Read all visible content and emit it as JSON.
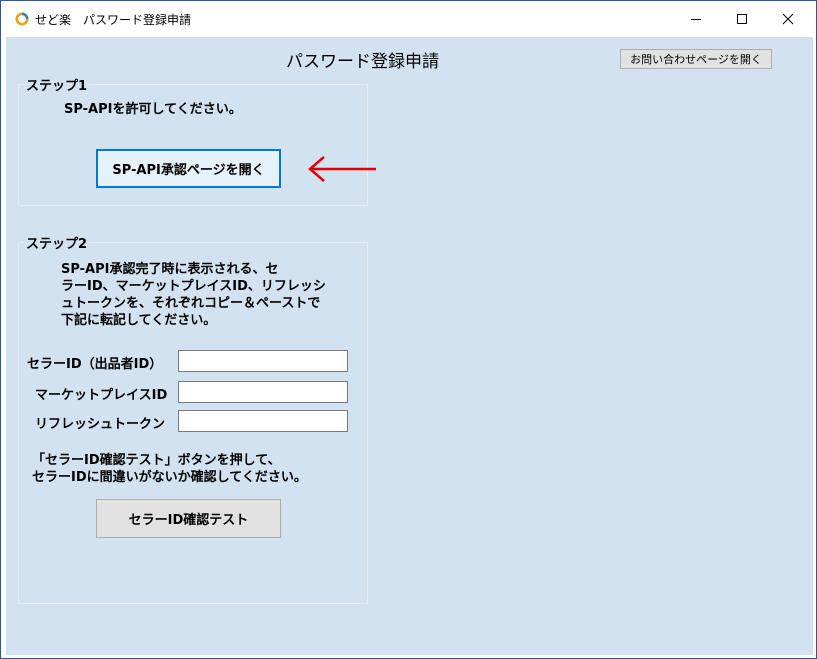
{
  "window": {
    "title": "せど楽　パスワード登録申請"
  },
  "header": {
    "title": "パスワード登録申請",
    "contact_button": "お問い合わせページを開く"
  },
  "step1": {
    "label": "ステップ1",
    "instruction": "SP-APIを許可してください。",
    "open_button": "SP-API承認ページを開く"
  },
  "step2": {
    "label": "ステップ2",
    "instruction": "SP-API承認完了時に表示される、セ\nラーID、マーケットプレイスID、リフレッシ\nュトークンを、それぞれコピー＆ペーストで\n下記に転記してください。",
    "fields": [
      {
        "label": "セラーID（出品者ID）",
        "value": ""
      },
      {
        "label": "マーケットプレイスID",
        "value": ""
      },
      {
        "label": "リフレッシュトークン",
        "value": ""
      }
    ],
    "note": "「セラーID確認テスト」ボタンを押して、\nセラーIDに間違いがないか確認してください。",
    "test_button": "セラーID確認テスト"
  },
  "colors": {
    "client_bg": "#d3e2f0",
    "primary_border": "#0078d7",
    "arrow": "#e00000"
  },
  "icons": {
    "app": "seraku-ring-icon",
    "minimize": "minimize-icon",
    "maximize": "maximize-icon",
    "close": "close-icon",
    "pointer": "arrow-left-icon"
  }
}
